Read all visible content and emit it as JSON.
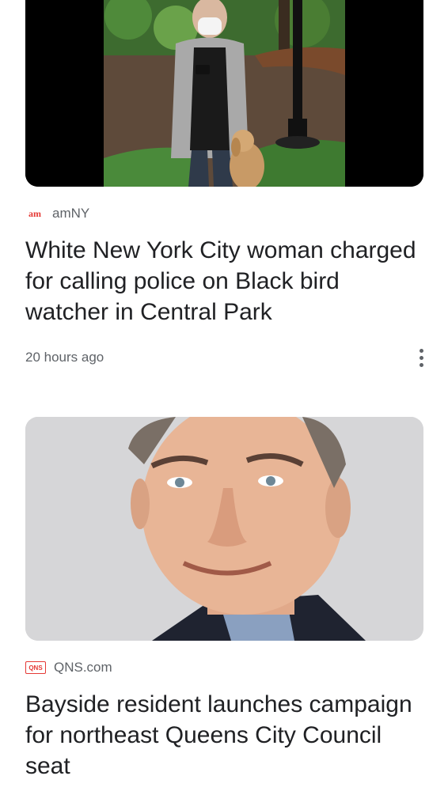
{
  "articles": [
    {
      "source": "amNY",
      "source_logo_text": "am",
      "source_logo_color": "#e53935",
      "headline": "White New York City woman charged for calling police on Black bird watcher in Central Park",
      "time": "20 hours ago",
      "more_icon": "more-vert-icon"
    },
    {
      "source": "QNS.com",
      "source_logo_text": "QNS",
      "source_logo_color": "#e53935",
      "headline": "Bayside resident launches campaign for northeast Queens City Council seat"
    }
  ],
  "colors": {
    "text_primary": "#202124",
    "text_secondary": "#5f6368"
  }
}
